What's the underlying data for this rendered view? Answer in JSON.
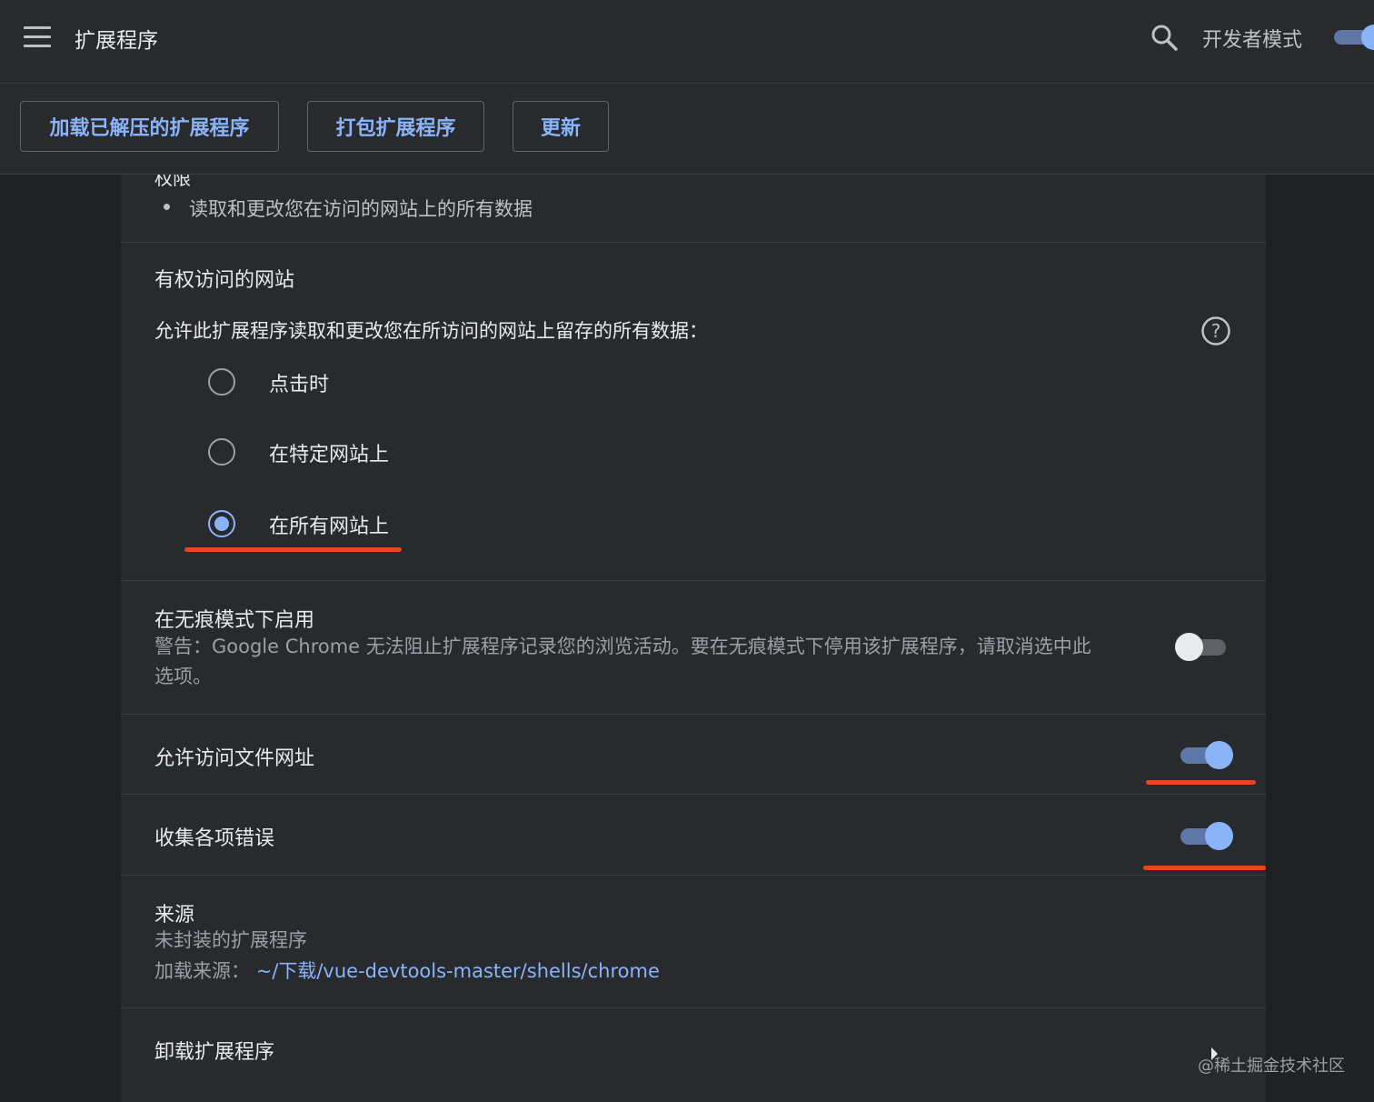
{
  "header": {
    "title": "扩展程序",
    "developer_mode_label": "开发者模式",
    "developer_mode_on": true
  },
  "toolbar": {
    "load_unpacked": "加载已解压的扩展程序",
    "pack": "打包扩展程序",
    "update": "更新"
  },
  "permissions": {
    "heading": "权限",
    "items": [
      "读取和更改您在访问的网站上的所有数据"
    ]
  },
  "site_access": {
    "heading": "有权访问的网站",
    "description": "允许此扩展程序读取和更改您在所访问的网站上留存的所有数据：",
    "options": [
      {
        "label": "点击时",
        "selected": false
      },
      {
        "label": "在特定网站上",
        "selected": false
      },
      {
        "label": "在所有网站上",
        "selected": true
      }
    ]
  },
  "incognito": {
    "heading": "在无痕模式下启用",
    "warning_line1": "警告：Google Chrome 无法阻止扩展程序记录您的浏览活动。要在无痕模式下停用该扩展程序，请取消选中此",
    "warning_line2": "选项。",
    "enabled": false
  },
  "file_urls": {
    "label": "允许访问文件网址",
    "enabled": true
  },
  "collect_errors": {
    "label": "收集各项错误",
    "enabled": true
  },
  "source": {
    "heading": "来源",
    "type": "未封装的扩展程序",
    "load_from_label": "加载来源：",
    "load_from_path": "~/下载/vue-devtools-master/shells/chrome"
  },
  "uninstall": {
    "label": "卸载扩展程序"
  },
  "watermark": "@稀土掘金技术社区",
  "colors": {
    "accent": "#8ab4f8",
    "annotation": "#e8471e",
    "background": "#202124",
    "card": "#292a2d"
  }
}
